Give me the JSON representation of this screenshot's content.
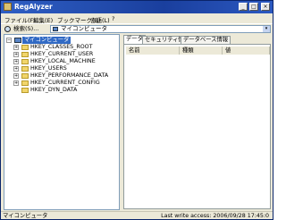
{
  "window": {
    "title": "RegAlyzer"
  },
  "titlebar_buttons": {
    "minimize": "_",
    "maximize": "□",
    "close": "×"
  },
  "menu": [
    "ファイル(F)",
    "編集(E)",
    "ブックマーク(B)",
    "言語(L)",
    "?"
  ],
  "toolbar": {
    "search_label": "検索(S)...",
    "address_value": "マイコンピュータ",
    "dropdown_glyph": "▾"
  },
  "tree": {
    "root": "マイコンピュータ",
    "root_expander": "−",
    "expander": "+",
    "keys": [
      "HKEY_CLASSES_ROOT",
      "HKEY_CURRENT_USER",
      "HKEY_LOCAL_MACHINE",
      "HKEY_USERS",
      "HKEY_PERFORMANCE_DATA",
      "HKEY_CURRENT_CONFIG",
      "HKEY_DYN_DATA"
    ]
  },
  "tabs": [
    "データ",
    "セキュリティ情報",
    "データベース情報"
  ],
  "columns": [
    "名前",
    "種類",
    "値"
  ],
  "status": {
    "left": "マイコンピュータ",
    "right": "Last write access: 2006/09/28 17:45:0"
  }
}
